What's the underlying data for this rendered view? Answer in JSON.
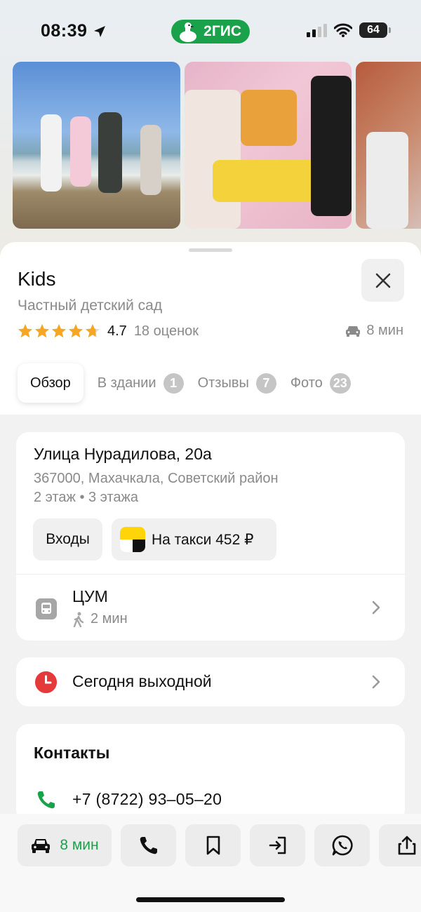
{
  "status_bar": {
    "time": "08:39",
    "brand": "2ГИС",
    "battery": "64"
  },
  "place": {
    "name": "Kids",
    "category": "Частный детский сад",
    "rating": 4.7,
    "rating_text": "4.7",
    "reviews_count": "18 оценок",
    "drive_time": "8 мин"
  },
  "tabs": [
    {
      "label": "Обзор",
      "badge": null
    },
    {
      "label": "В здании",
      "badge": "1"
    },
    {
      "label": "Отзывы",
      "badge": "7"
    },
    {
      "label": "Фото",
      "badge": "23"
    }
  ],
  "address": {
    "street": "Улица Нурадилова, 20а",
    "city": "367000, Махачкала, Советский район",
    "floors": "2 этаж • 3 этажа",
    "entrances_label": "Входы",
    "taxi_label": "На такси 452 ₽"
  },
  "transit": {
    "stop": "ЦУМ",
    "walk_time": "2 мин"
  },
  "hours": {
    "status": "Сегодня выходной"
  },
  "contacts": {
    "heading": "Контакты",
    "phone": "+7 (8722) 93‒05‒20"
  },
  "actions": {
    "route_time": "8 мин"
  },
  "colors": {
    "brand_green": "#19a24a",
    "star": "#f5a623",
    "closed_red": "#e53a3a",
    "badge_gray": "#c5c5c5"
  },
  "icons": [
    "location-arrow-icon",
    "goose-logo-icon",
    "signal-icon",
    "wifi-icon",
    "battery-icon",
    "close-icon",
    "star-icon",
    "car-icon",
    "bus-icon",
    "walk-icon",
    "chevron-right-icon",
    "clock-icon",
    "phone-icon",
    "bookmark-icon",
    "enter-icon",
    "whatsapp-icon",
    "share-icon"
  ]
}
